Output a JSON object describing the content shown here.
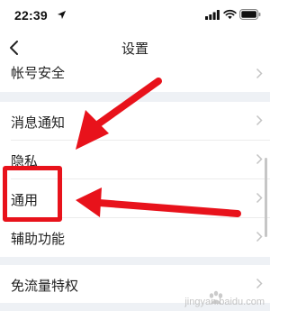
{
  "status_bar": {
    "time": "22:39",
    "location_icon": "location-arrow-icon",
    "signal_icon": "cellular-signal-icon",
    "wifi_icon": "wifi-icon",
    "battery_icon": "battery-icon"
  },
  "nav": {
    "back_icon": "chevron-left-icon",
    "title": "设置"
  },
  "groups": [
    {
      "items": [
        {
          "label": "帐号安全",
          "icon": "chevron-right-icon"
        }
      ]
    },
    {
      "items": [
        {
          "label": "消息通知",
          "icon": "chevron-right-icon"
        },
        {
          "label": "隐私",
          "icon": "chevron-right-icon"
        },
        {
          "label": "通用",
          "icon": "chevron-right-icon"
        },
        {
          "label": "辅助功能",
          "icon": "chevron-right-icon"
        }
      ]
    },
    {
      "items": [
        {
          "label": "免流量特权",
          "icon": "chevron-right-icon"
        }
      ]
    }
  ],
  "annotations": {
    "highlight_color": "#e8121b",
    "arrow_color": "#e8121b",
    "highlighted_item": "通用"
  },
  "watermark": {
    "text": "jingyan.baidu.com"
  },
  "colors": {
    "background": "#eef1f5",
    "row_background": "#ffffff",
    "text": "#222222",
    "chevron": "#c4c4c4"
  }
}
